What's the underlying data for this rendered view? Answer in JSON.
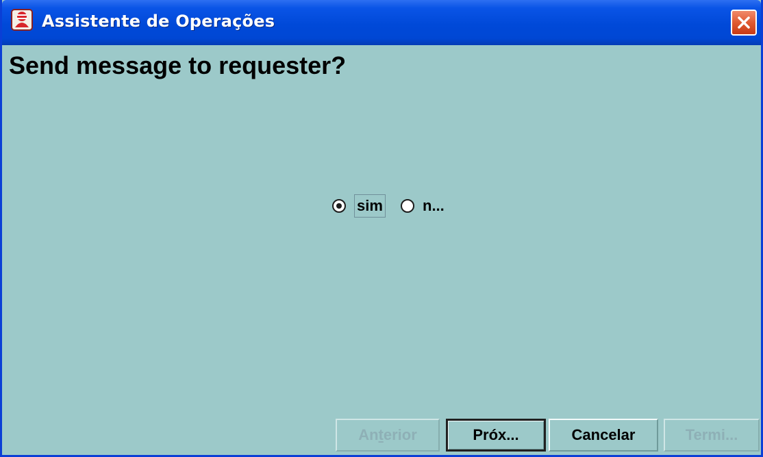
{
  "window": {
    "title": "Assistente de Operações"
  },
  "main": {
    "heading": "Send message to requester?"
  },
  "radio_group": {
    "options": [
      {
        "label": "sim",
        "selected": true
      },
      {
        "label": "n...",
        "selected": false
      }
    ]
  },
  "buttons": {
    "previous": {
      "label_pre": "An",
      "label_mnemonic": "t",
      "label_post": "erior",
      "enabled": false
    },
    "next": {
      "label": "Próx...",
      "enabled": true,
      "default": true
    },
    "cancel": {
      "label": "Cancelar",
      "enabled": true
    },
    "finish": {
      "label": "Termi...",
      "enabled": false
    }
  },
  "colors": {
    "titlebar": "#0047d4",
    "background": "#9cc9c9",
    "close_button": "#e05a32",
    "disabled_text": "#8eb0b6"
  },
  "icons": [
    "app-icon",
    "close-icon",
    "radio-selected-icon",
    "radio-unselected-icon"
  ]
}
